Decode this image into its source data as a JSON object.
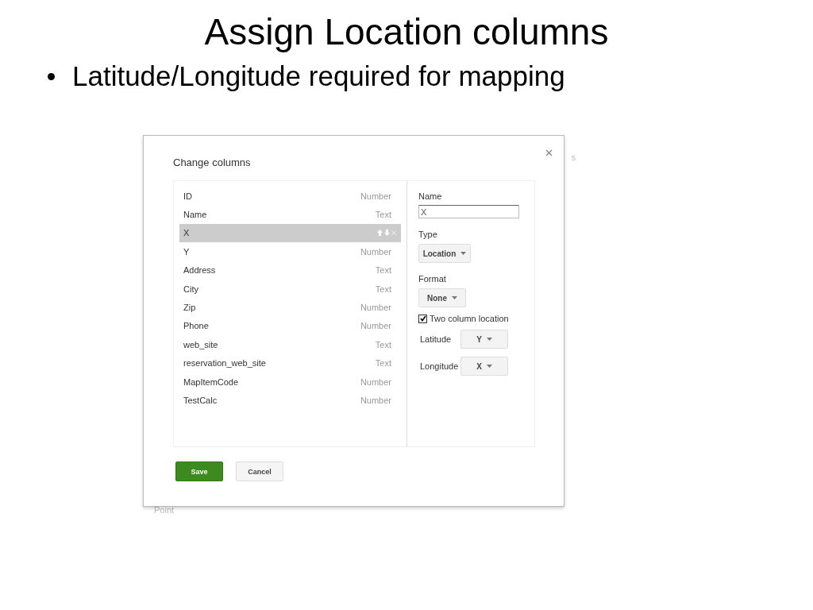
{
  "slide": {
    "title": "Assign Location columns",
    "bullets": [
      "Latitude/Longitude required for mapping"
    ]
  },
  "background_text": [
    "s",
    "Point"
  ],
  "dialog": {
    "title": "Change columns",
    "columns": [
      {
        "name": "ID",
        "type": "Number",
        "selected": false
      },
      {
        "name": "Name",
        "type": "Text",
        "selected": false
      },
      {
        "name": "X",
        "selected": true
      },
      {
        "name": "Y",
        "type": "Number",
        "selected": false
      },
      {
        "name": "Address",
        "type": "Text",
        "selected": false
      },
      {
        "name": "City",
        "type": "Text",
        "selected": false
      },
      {
        "name": "Zip",
        "type": "Number",
        "selected": false
      },
      {
        "name": "Phone",
        "type": "Number",
        "selected": false
      },
      {
        "name": "web_site",
        "type": "Text",
        "selected": false
      },
      {
        "name": "reservation_web_site",
        "type": "Text",
        "selected": false
      },
      {
        "name": "MapItemCode",
        "type": "Number",
        "selected": false
      },
      {
        "name": "TestCalc",
        "type": "Number",
        "selected": false
      }
    ],
    "details": {
      "name_label": "Name",
      "name_value": "X",
      "type_label": "Type",
      "type_value": "Location",
      "format_label": "Format",
      "format_value": "None",
      "two_column": {
        "label": "Two column location",
        "checked": true
      },
      "latitude": {
        "label": "Latitude",
        "value": "Y"
      },
      "longitude": {
        "label": "Longitude",
        "value": "X"
      }
    },
    "buttons": [
      {
        "label": "Save",
        "kind": "primary"
      },
      {
        "label": "Cancel",
        "kind": "secondary"
      }
    ]
  }
}
